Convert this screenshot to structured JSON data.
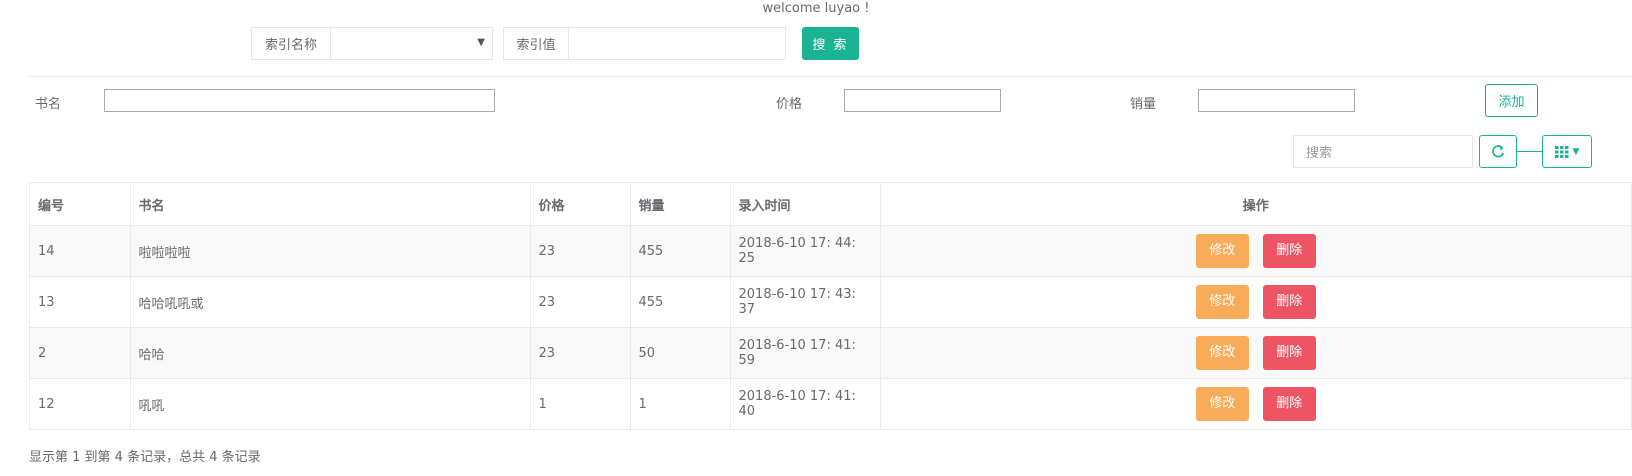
{
  "header": {
    "welcome": "welcome luyao !"
  },
  "index_search": {
    "name_label": "索引名称",
    "name_value": "",
    "value_label": "索引值",
    "value_value": "",
    "search_button": "搜 索"
  },
  "add_form": {
    "title_label": "书名",
    "price_label": "价格",
    "sales_label": "销量",
    "add_button": "添加"
  },
  "toolbar": {
    "search_placeholder": "搜索"
  },
  "table": {
    "columns": [
      "编号",
      "书名",
      "价格",
      "销量",
      "录入时间",
      "操作"
    ],
    "rows": [
      {
        "id": "14",
        "title": "啦啦啦啦",
        "price": "23",
        "sales": "455",
        "time": "2018-6-10 17: 44: 25",
        "edit": "修改",
        "delete": "删除"
      },
      {
        "id": "13",
        "title": "哈哈吼吼或",
        "price": "23",
        "sales": "455",
        "time": "2018-6-10 17: 43: 37",
        "edit": "修改",
        "delete": "删除"
      },
      {
        "id": "2",
        "title": "哈哈",
        "price": "23",
        "sales": "50",
        "time": "2018-6-10 17: 41: 59",
        "edit": "修改",
        "delete": "删除"
      },
      {
        "id": "12",
        "title": "吼吼",
        "price": "1",
        "sales": "1",
        "time": "2018-6-10 17: 41: 40",
        "edit": "修改",
        "delete": "删除"
      }
    ]
  },
  "footer": {
    "summary": "显示第 1 到第 4 条记录，总共 4 条记录"
  },
  "colors": {
    "primary": "#1ab394",
    "warning": "#f8ac59",
    "danger": "#ed5565"
  },
  "icons": {
    "refresh": "refresh-icon",
    "columns": "grid-icon"
  }
}
